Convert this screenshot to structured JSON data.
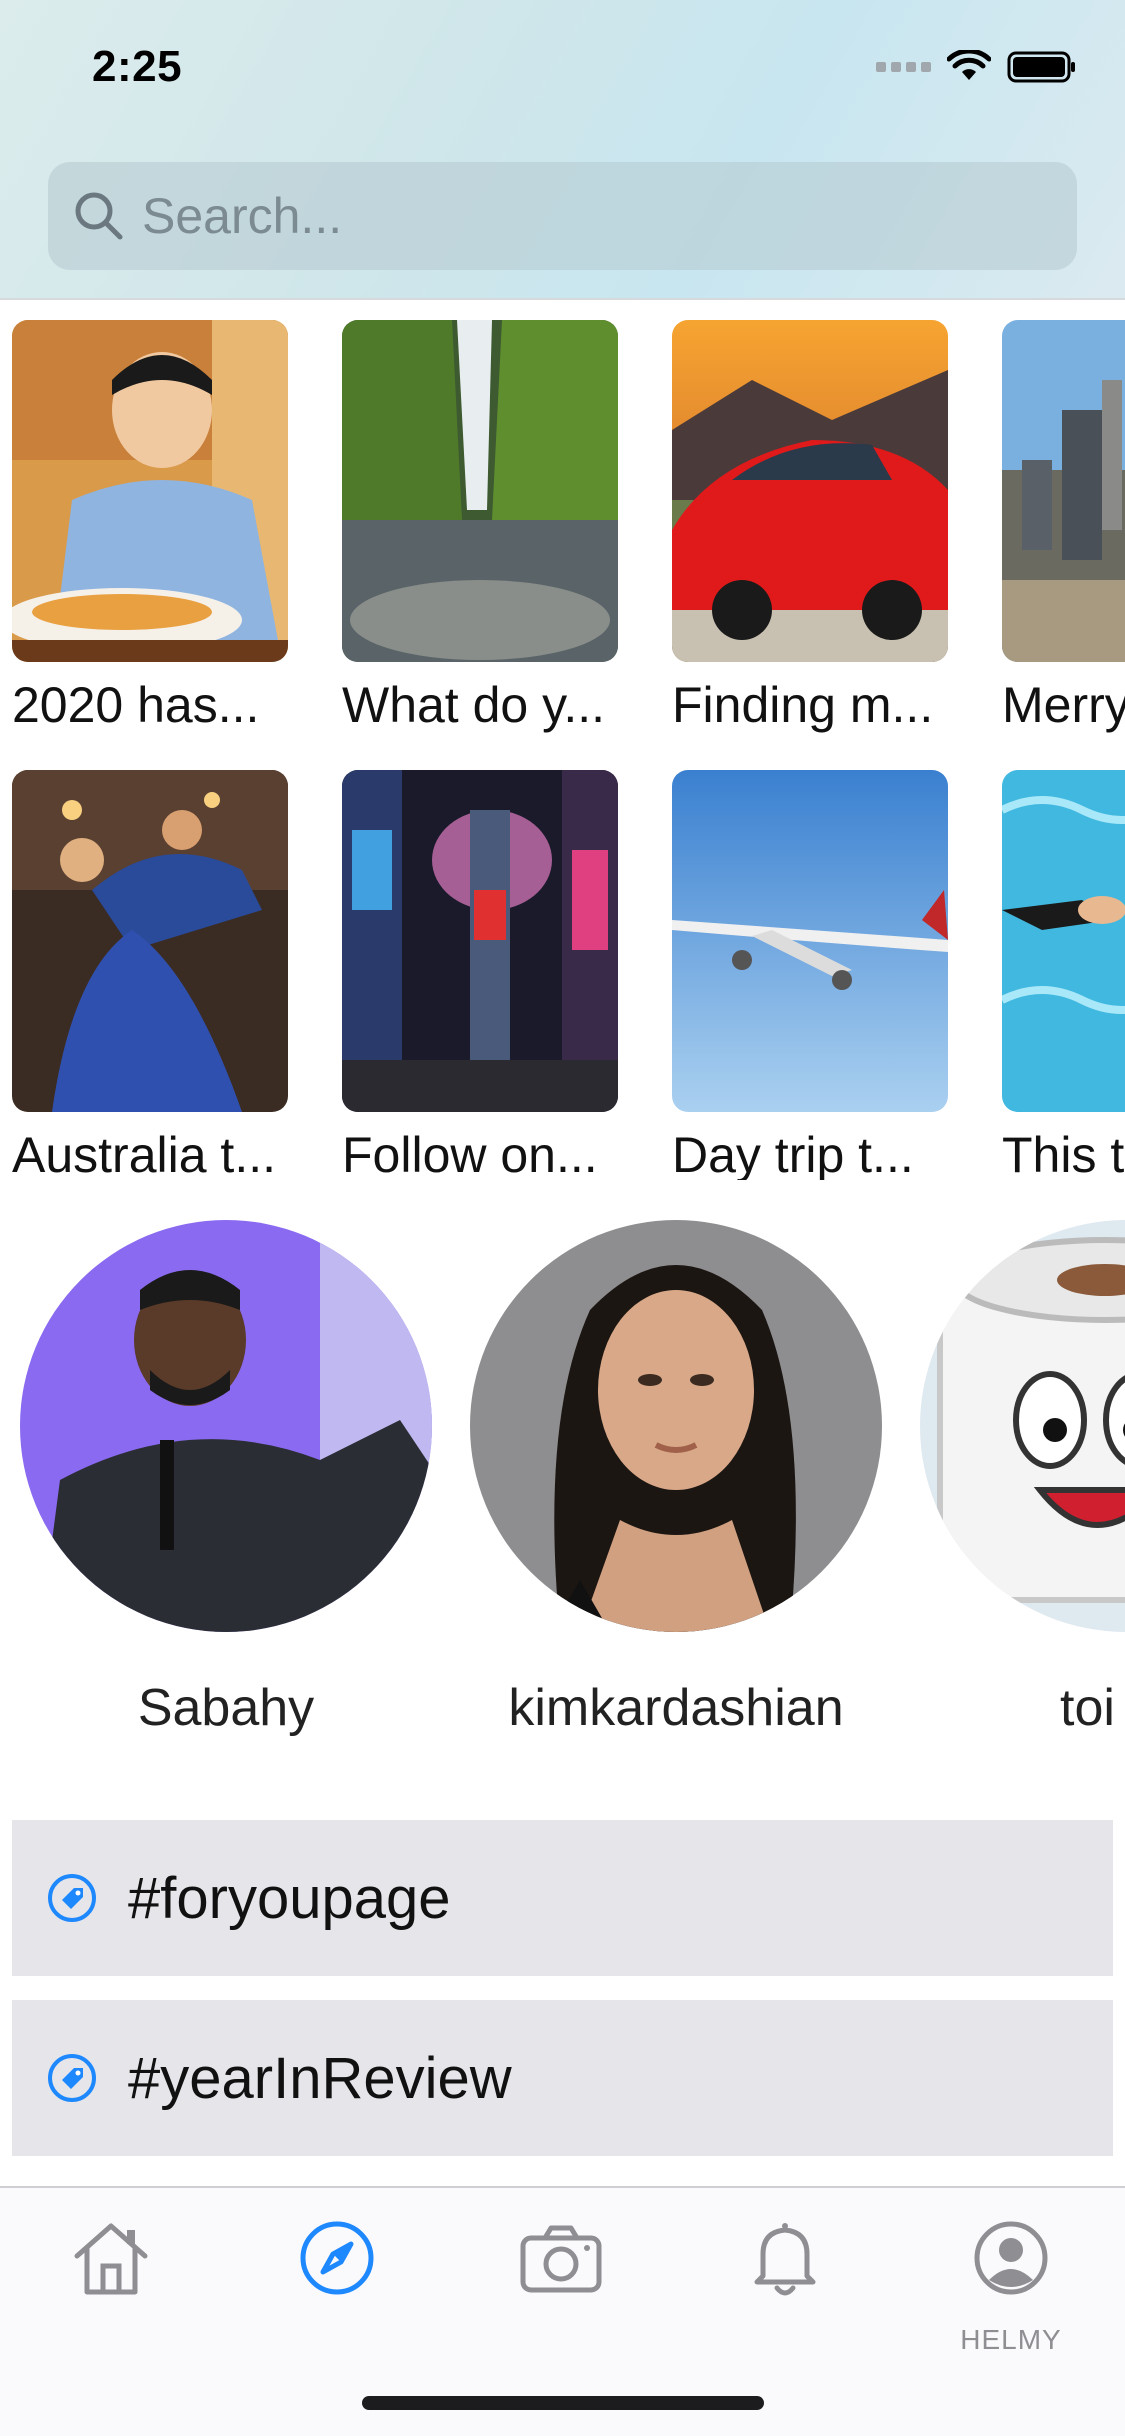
{
  "status_bar": {
    "time": "2:25"
  },
  "search": {
    "placeholder": "Search..."
  },
  "stories": [
    {
      "caption": "2020 has...",
      "image": "boy-eating-photo"
    },
    {
      "caption": "What do y...",
      "image": "waterfall-photo"
    },
    {
      "caption": "Finding m...",
      "image": "red-car-photo"
    },
    {
      "caption": "Merry",
      "image": "city-skyline-photo"
    },
    {
      "caption": "Australia t...",
      "image": "dancers-photo"
    },
    {
      "caption": "Follow on...",
      "image": "times-square-photo"
    },
    {
      "caption": "Day trip t...",
      "image": "airplane-photo"
    },
    {
      "caption": "This t",
      "image": "swimmer-photo"
    }
  ],
  "profiles": [
    {
      "name": "Sabahy",
      "image": "man-speaking-photo"
    },
    {
      "name": "kimkardashian",
      "image": "woman-portrait-photo"
    },
    {
      "name": "toi",
      "image": "toilet-paper-cartoon"
    }
  ],
  "tags": [
    {
      "label": "#foryoupage",
      "icon": "tag-icon"
    },
    {
      "label": "#yearInReview",
      "icon": "tag-icon"
    }
  ],
  "tabbar": {
    "items": [
      {
        "icon": "home-icon",
        "label": ""
      },
      {
        "icon": "compass-icon",
        "label": "",
        "active": true
      },
      {
        "icon": "camera-icon",
        "label": ""
      },
      {
        "icon": "bell-icon",
        "label": ""
      },
      {
        "icon": "profile-icon",
        "label": "HELMY"
      }
    ]
  },
  "colors": {
    "accent": "#1e88ff",
    "tab_inactive": "#8e8e93",
    "tag_bg": "#e5e5ea"
  }
}
